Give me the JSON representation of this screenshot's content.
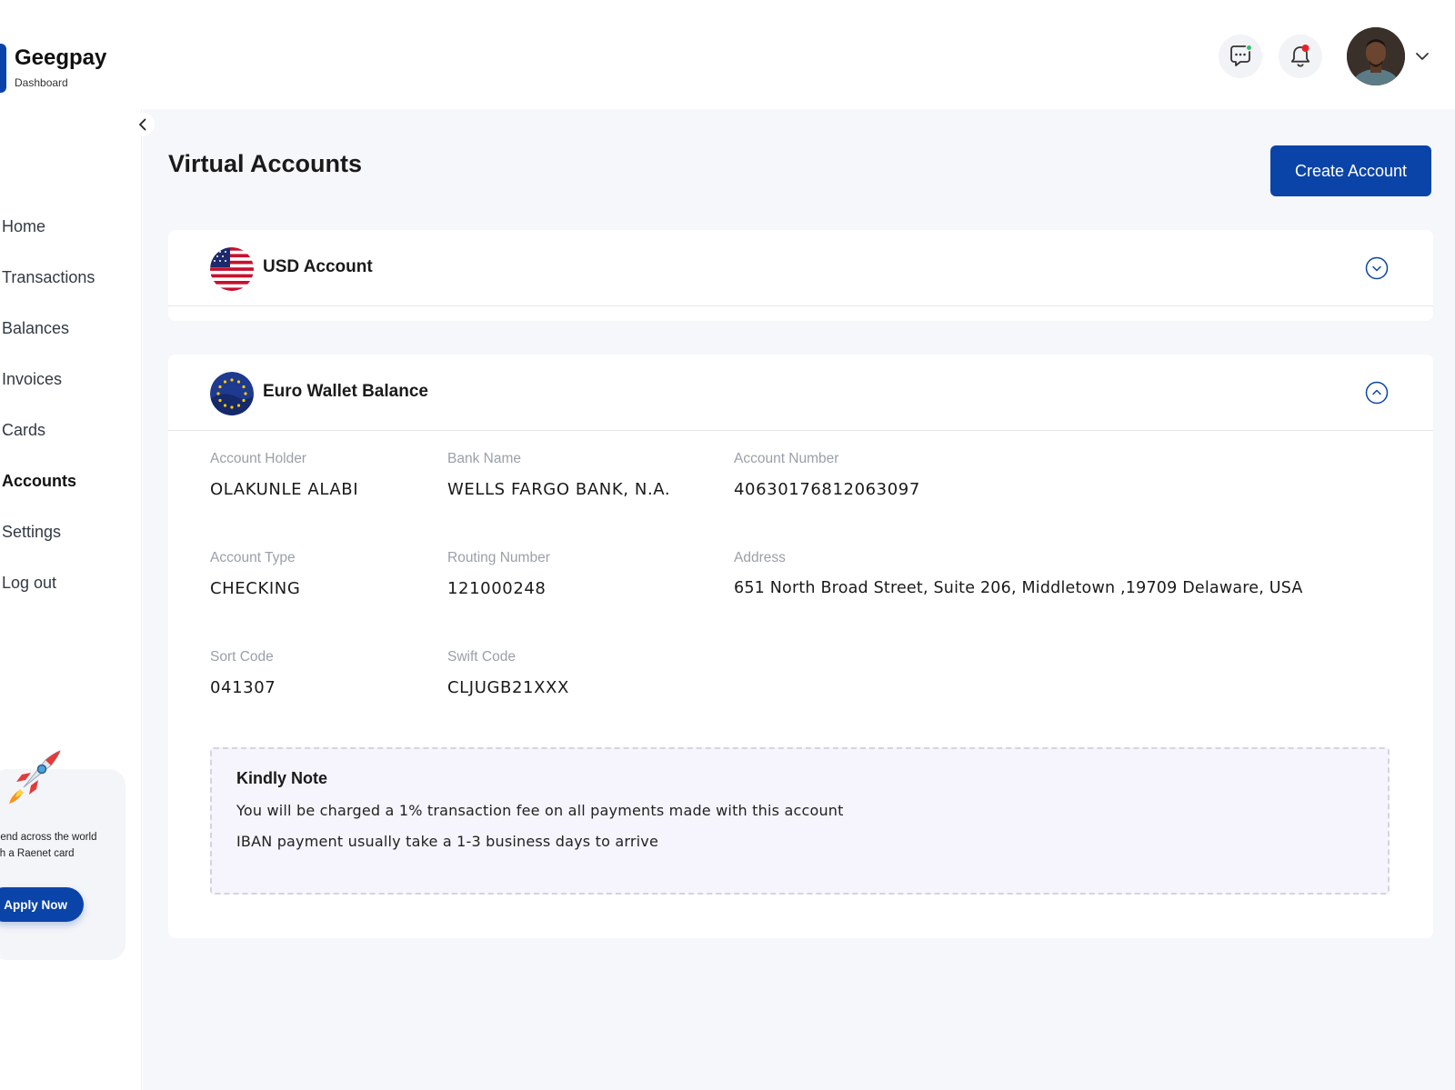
{
  "brand": {
    "name": "Geegpay",
    "subtitle": "Dashboard"
  },
  "header": {
    "chat_icon": "chat-bubble-icon",
    "bell_icon": "bell-icon",
    "bell_badge_color": "#e8222a",
    "chat_badge_color": "#2ec26a",
    "avatar": "user-avatar",
    "avatar_menu_icon": "chevron-down-icon"
  },
  "sidebar": {
    "items": [
      {
        "label": "Home"
      },
      {
        "label": "Transactions"
      },
      {
        "label": "Balances"
      },
      {
        "label": "Invoices"
      },
      {
        "label": "Cards"
      },
      {
        "label": "Accounts",
        "active": true
      },
      {
        "label": "Settings"
      },
      {
        "label": "Log out"
      }
    ],
    "promo": {
      "icon": "rocket-icon",
      "text": "pend across the world\nith a Raenet card",
      "button": "Apply Now"
    }
  },
  "page": {
    "title": "Virtual Accounts",
    "create_button": "Create Account"
  },
  "accounts": [
    {
      "title": "USD Account",
      "flag": "us-flag-icon",
      "expanded": false
    },
    {
      "title": "Euro Wallet Balance",
      "flag": "eu-flag-icon",
      "expanded": true,
      "details": {
        "holder_label": "Account Holder",
        "holder": "OLAKUNLE ALABI",
        "bank_label": "Bank Name",
        "bank": "WELLS FARGO BANK, N.A.",
        "number_label": "Account Number",
        "number": "40630176812063097",
        "type_label": "Account Type",
        "type": "CHECKING",
        "routing_label": "Routing Number",
        "routing": "121000248",
        "address_label": "Address",
        "address": "651 North Broad Street, Suite 206, Middletown ,19709 Delaware, USA",
        "sort_label": "Sort Code",
        "sort": "041307",
        "swift_label": "Swift Code",
        "swift": "CLJUGB21XXX"
      },
      "note": {
        "title": "Kindly Note",
        "lines": [
          "You will be charged a 1% transaction fee on all payments made with this account",
          "IBAN payment usually take a 1-3 business days to arrive"
        ]
      }
    }
  ],
  "colors": {
    "primary": "#0b44a8",
    "background": "#f6f7fb",
    "note_bg": "#f6f4fc"
  }
}
